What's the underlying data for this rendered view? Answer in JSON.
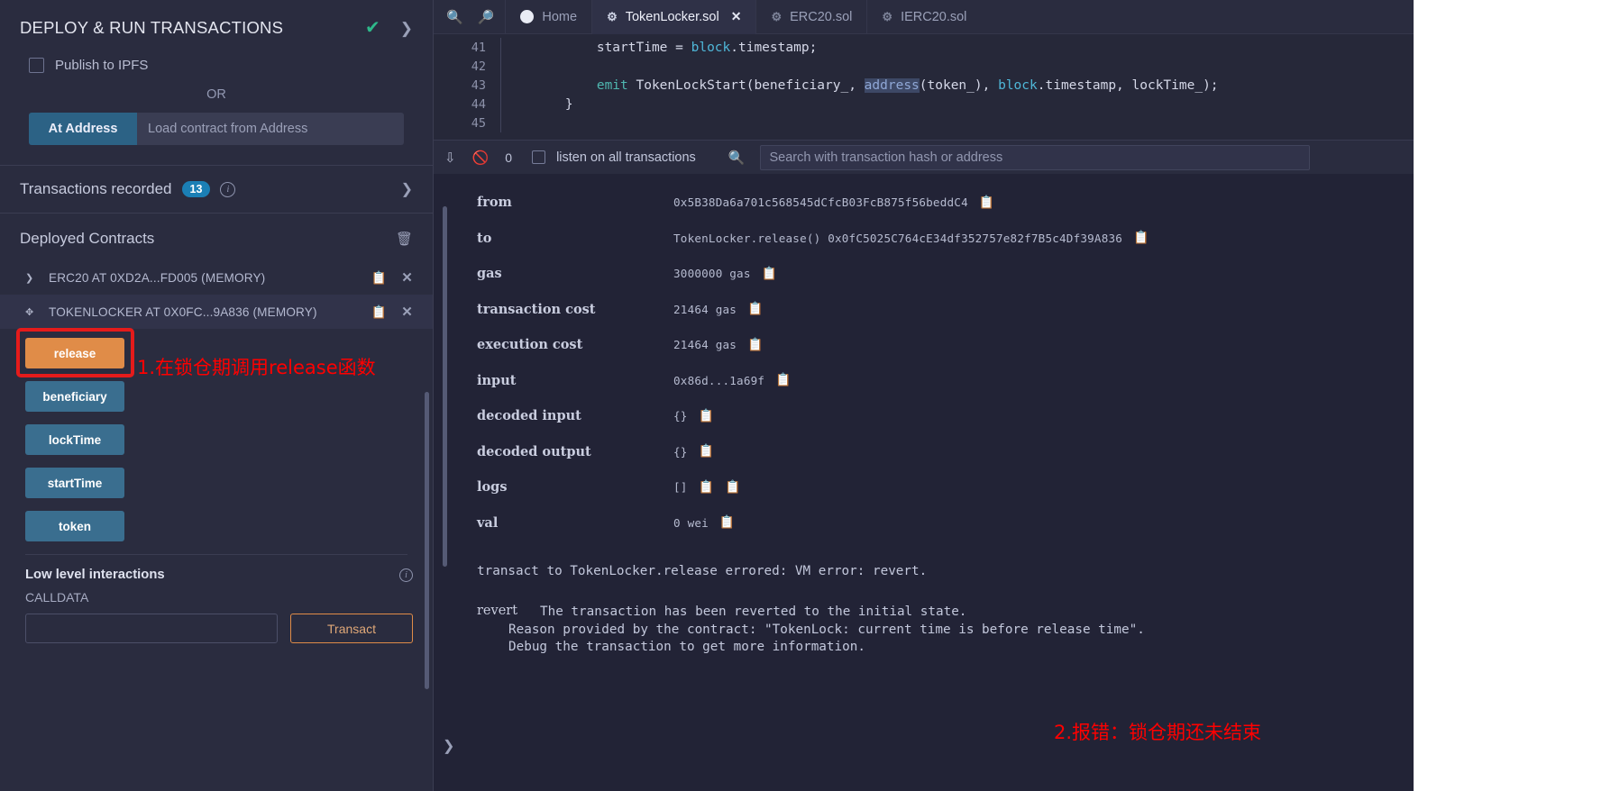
{
  "sidebar": {
    "panel_title": "DEPLOY & RUN TRANSACTIONS",
    "check_icon": "check-icon",
    "expand_icon": "chevron-right-icon",
    "publish_ipfs_label": "Publish to IPFS",
    "or_label": "OR",
    "at_address_button": "At Address",
    "at_address_placeholder": "Load contract from Address",
    "transactions_recorded_label": "Transactions recorded",
    "transactions_recorded_count": "13",
    "deployed_contracts_title": "Deployed Contracts",
    "contracts": [
      {
        "name": "ERC20 AT 0XD2A...FD005 (MEMORY)",
        "expanded": false
      },
      {
        "name": "TOKENLOCKER AT 0X0FC...9A836 (MEMORY)",
        "expanded": true
      }
    ],
    "functions": [
      {
        "label": "release",
        "kind": "write"
      },
      {
        "label": "beneficiary",
        "kind": "read"
      },
      {
        "label": "lockTime",
        "kind": "read"
      },
      {
        "label": "startTime",
        "kind": "read"
      },
      {
        "label": "token",
        "kind": "read"
      }
    ],
    "low_level_title": "Low level interactions",
    "calldata_label": "CALLDATA",
    "calldata_value": "",
    "transact_button": "Transact"
  },
  "annotations": {
    "one": "1.在锁仓期调用release函数",
    "two": "2.报错：锁仓期还未结束",
    "highlight_color": "#e51b1b",
    "text_color": "#ff0000"
  },
  "tabs": {
    "zoom_out_icon": "zoom-out-icon",
    "zoom_in_icon": "zoom-in-icon",
    "items": [
      {
        "label": "Home",
        "icon": "home-icon",
        "active": false,
        "closable": false
      },
      {
        "label": "TokenLocker.sol",
        "icon": "solidity-icon",
        "active": true,
        "closable": true
      },
      {
        "label": "ERC20.sol",
        "icon": "solidity-icon",
        "active": false,
        "closable": false
      },
      {
        "label": "IERC20.sol",
        "icon": "solidity-icon",
        "active": false,
        "closable": false
      }
    ]
  },
  "editor": {
    "lines": [
      {
        "number": "41",
        "segments": [
          {
            "t": "        startTime = ",
            "c": "plain"
          },
          {
            "t": "block",
            "c": "blue"
          },
          {
            "t": ".timestamp;",
            "c": "plain"
          }
        ]
      },
      {
        "number": "42",
        "segments": [
          {
            "t": "",
            "c": "plain"
          }
        ]
      },
      {
        "number": "43",
        "segments": [
          {
            "t": "        ",
            "c": "plain"
          },
          {
            "t": "emit",
            "c": "green"
          },
          {
            "t": " TokenLockStart(beneficiary_, ",
            "c": "plain"
          },
          {
            "t": "address",
            "c": "sel"
          },
          {
            "t": "(token_), ",
            "c": "plain"
          },
          {
            "t": "block",
            "c": "blue"
          },
          {
            "t": ".timestamp, lockTime_);",
            "c": "plain"
          }
        ]
      },
      {
        "number": "44",
        "segments": [
          {
            "t": "    }",
            "c": "plain"
          }
        ]
      },
      {
        "number": "45",
        "segments": [
          {
            "t": "",
            "c": "plain"
          }
        ]
      }
    ]
  },
  "terminal": {
    "toolbar": {
      "collapse_icon": "chevrons-down-icon",
      "clear_icon": "ban-icon",
      "pending_count": "0",
      "listen_label": "listen on all transactions",
      "search_icon": "search-icon",
      "search_placeholder": "Search with transaction hash or address",
      "search_value": ""
    },
    "details": [
      {
        "key": "from",
        "value": "0x5B38Da6a701c568545dCfcB03FcB875f56beddC4",
        "copy": true,
        "mono": true
      },
      {
        "key": "to",
        "value": "TokenLocker.release() 0x0fC5025C764cE34df352757e82f7B5c4Df39A836",
        "copy": true,
        "mono": true
      },
      {
        "key": "gas",
        "value": "3000000 gas",
        "copy": true,
        "mono": true
      },
      {
        "key": "transaction cost",
        "value": "21464 gas",
        "copy": true,
        "mono": true
      },
      {
        "key": "execution cost",
        "value": "21464 gas",
        "copy": true,
        "mono": true
      },
      {
        "key": "input",
        "value": "0x86d...1a69f",
        "copy": true,
        "mono": true
      },
      {
        "key": "decoded input",
        "value": "{}",
        "copy": true,
        "mono": true
      },
      {
        "key": "decoded output",
        "value": "{}",
        "copy": true,
        "mono": true
      },
      {
        "key": "logs",
        "value": "[]",
        "copy": true,
        "copy2": true,
        "mono": true
      },
      {
        "key": "val",
        "value": "0 wei",
        "copy": true,
        "mono": true
      }
    ],
    "error_line": "transact to TokenLocker.release errored: VM error: revert.",
    "revert_key": "revert",
    "revert_line_1": "The transaction has been reverted to the initial state.",
    "revert_line_2_prefix": "Reason provided by the contract: ",
    "revert_reason": "\"TokenLock: current time is before release time\".",
    "revert_line_3": "Debug the transaction to get more information."
  }
}
